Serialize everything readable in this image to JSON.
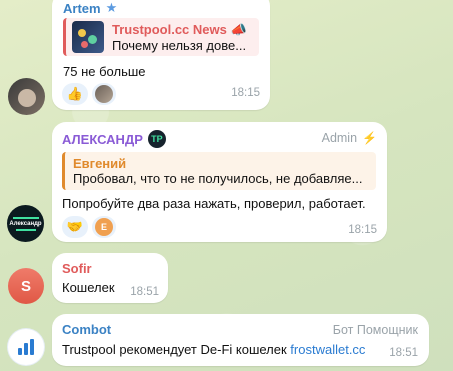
{
  "messages": [
    {
      "sender": "Artem",
      "sender_color": "#3b82c4",
      "quote_title": "Trustpool.cc News 📣",
      "quote_text": "Почему нельзя дове...",
      "quote_color": "#e05b5b",
      "text": "75 не больше",
      "time": "18:15"
    },
    {
      "sender": "АЛЕКСАНДР",
      "sender_color": "#8a5bd6",
      "badge": "TP",
      "role": "Admin",
      "quote_title": "Евгений",
      "quote_text": "Пробовал, что то не получилось, не добавляе...",
      "quote_color": "#e08a2c",
      "text": "Попробуйте два раза нажать, проверил, работает.",
      "time": "18:15",
      "avatar_label": "Александр"
    },
    {
      "sender": "Sofir",
      "sender_color": "#e05b5b",
      "avatar_letter": "S",
      "text": "Кошелек",
      "time": "18:51"
    },
    {
      "sender": "Combot",
      "sender_color": "#3b82c4",
      "role": "Бот Помощник",
      "text": "Trustpool рекомендует De-Fi кошелек ",
      "link": "frostwallet.cc",
      "time": "18:51"
    }
  ],
  "icons": {
    "thumbs_up": "👍",
    "handshake": "🤝",
    "reaction_letter": "E",
    "lightning": "⚡",
    "star": "★"
  },
  "colors": {
    "bubble": "#ffffff",
    "link": "#2a7bd1",
    "reaction_bg": "#e8f1fb"
  }
}
